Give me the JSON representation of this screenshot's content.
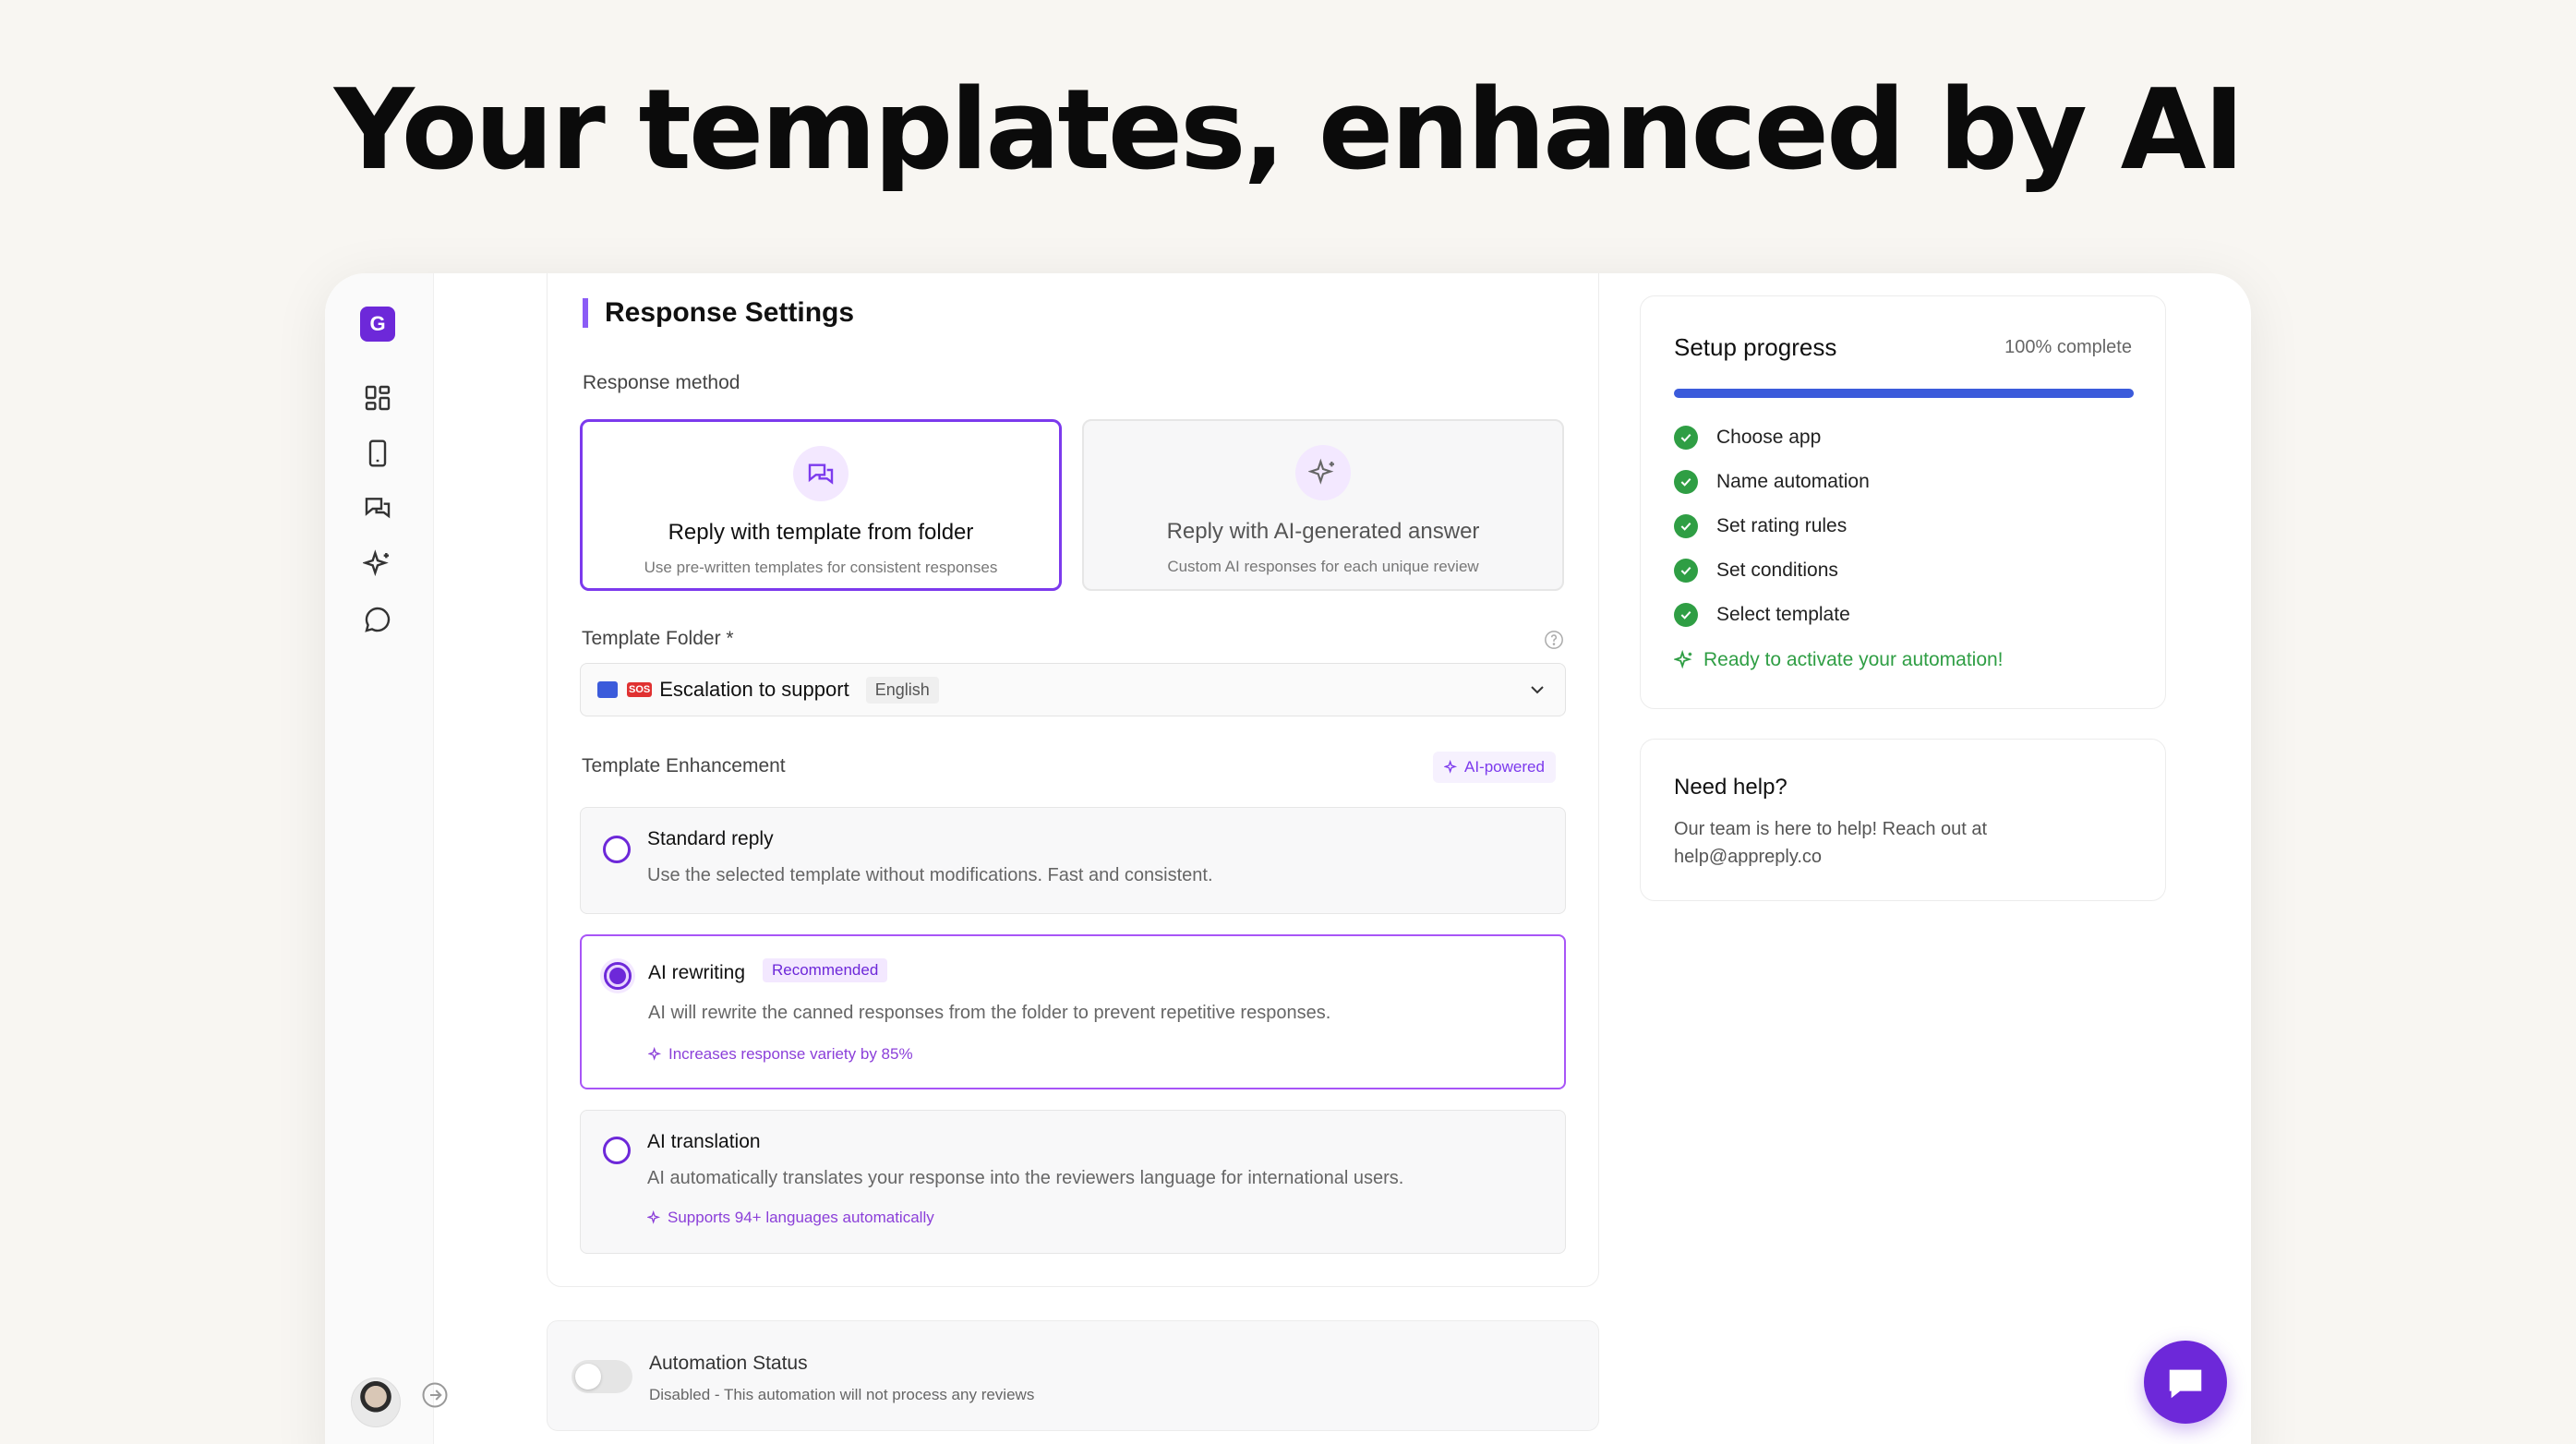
{
  "headline": "Your templates, enhanced by AI",
  "sidebar": {
    "logo_letter": "G",
    "items": [
      "dashboard-icon",
      "phone-icon",
      "chats-icon",
      "sparkles-icon",
      "message-icon"
    ]
  },
  "response_settings": {
    "title": "Response Settings",
    "method_label": "Response method",
    "methods": [
      {
        "title": "Reply with template from folder",
        "subtitle": "Use pre-written templates for consistent responses",
        "selected": true
      },
      {
        "title": "Reply with AI-generated answer",
        "subtitle": "Custom AI responses for each unique review",
        "selected": false
      }
    ],
    "folder_label": "Template Folder *",
    "folder_value": "Escalation to support",
    "folder_emoji": "SOS",
    "folder_language": "English",
    "enhancement_label": "Template Enhancement",
    "ai_badge": "AI-powered",
    "options": [
      {
        "title": "Standard reply",
        "desc": "Use the selected template without modifications. Fast and consistent.",
        "note": "",
        "selected": false
      },
      {
        "title": "AI rewriting",
        "badge": "Recommended",
        "desc": "AI will rewrite the canned responses from the folder to prevent repetitive responses.",
        "note": "Increases response variety by 85%",
        "selected": true
      },
      {
        "title": "AI translation",
        "desc": "AI automatically translates your response into the reviewers language for international users.",
        "note": "Supports 94+ languages automatically",
        "selected": false
      }
    ]
  },
  "automation_status": {
    "title": "Automation Status",
    "desc": "Disabled - This automation will not process any reviews",
    "enabled": false
  },
  "setup_progress": {
    "title": "Setup progress",
    "percent_label": "100% complete",
    "percent": 100,
    "steps": [
      "Choose app",
      "Name automation",
      "Set rating rules",
      "Set conditions",
      "Select template"
    ],
    "ready": "Ready to activate your automation!"
  },
  "help": {
    "title": "Need help?",
    "text": "Our team is here to help! Reach out at help@appreply.co"
  },
  "colors": {
    "accent": "#6d28d9",
    "progress": "#3b5bdb",
    "success": "#2f9e44"
  }
}
